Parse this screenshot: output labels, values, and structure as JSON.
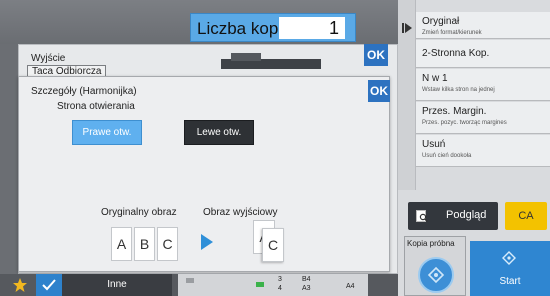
{
  "header": {
    "copies_label": "Liczba kopii",
    "copies_value": "1"
  },
  "right_menu": {
    "items": [
      {
        "title": "Oryginał",
        "subtitle": "Zmień format/kierunek"
      },
      {
        "title": "2-Stronna Kop.",
        "subtitle": ""
      },
      {
        "title": "N w 1",
        "subtitle": "Wstaw kilka stron na jednej"
      },
      {
        "title": "Przes. Margin.",
        "subtitle": "Przes. pozyc. tworząc margines"
      },
      {
        "title": "Usuń",
        "subtitle": "Usuń cień dookoła"
      }
    ],
    "preview_label": "Podgląd",
    "ca_label": "CA",
    "proof_label": "Kopia próbna",
    "start_label": "Start"
  },
  "background_panel": {
    "output_label": "Wyjście",
    "output_value": "Taca Odbiorcza",
    "ok_label": "OK"
  },
  "dialog": {
    "title": "Szczegóły (Harmonijka)",
    "ok_label": "OK",
    "opening_label": "Strona otwierania",
    "right_open_label": "Prawe otw.",
    "left_open_label": "Lewe otw.",
    "original_image_label": "Oryginalny obraz",
    "output_image_label": "Obraz wyjściowy",
    "original_pages": [
      "A",
      "B",
      "C"
    ],
    "output_pages": [
      "A",
      "C"
    ]
  },
  "bottom_bar": {
    "other_label": "Inne",
    "trays": [
      {
        "num": "3",
        "size": "B4"
      },
      {
        "num": "4",
        "size": "A3"
      }
    ],
    "bypass_size": "A4"
  },
  "colors": {
    "accent_blue": "#2d72c0",
    "selected_button": "#5fb0ef",
    "ca_yellow": "#f3c200",
    "start_blue": "#2f86d1"
  },
  "icons": {
    "collapse": "collapse-arrow-icon",
    "preview": "preview-icon",
    "proof": "diamond-icon",
    "start": "diamond-icon",
    "star": "star-icon",
    "check": "check-icon",
    "arrow": "arrow-right-icon"
  }
}
